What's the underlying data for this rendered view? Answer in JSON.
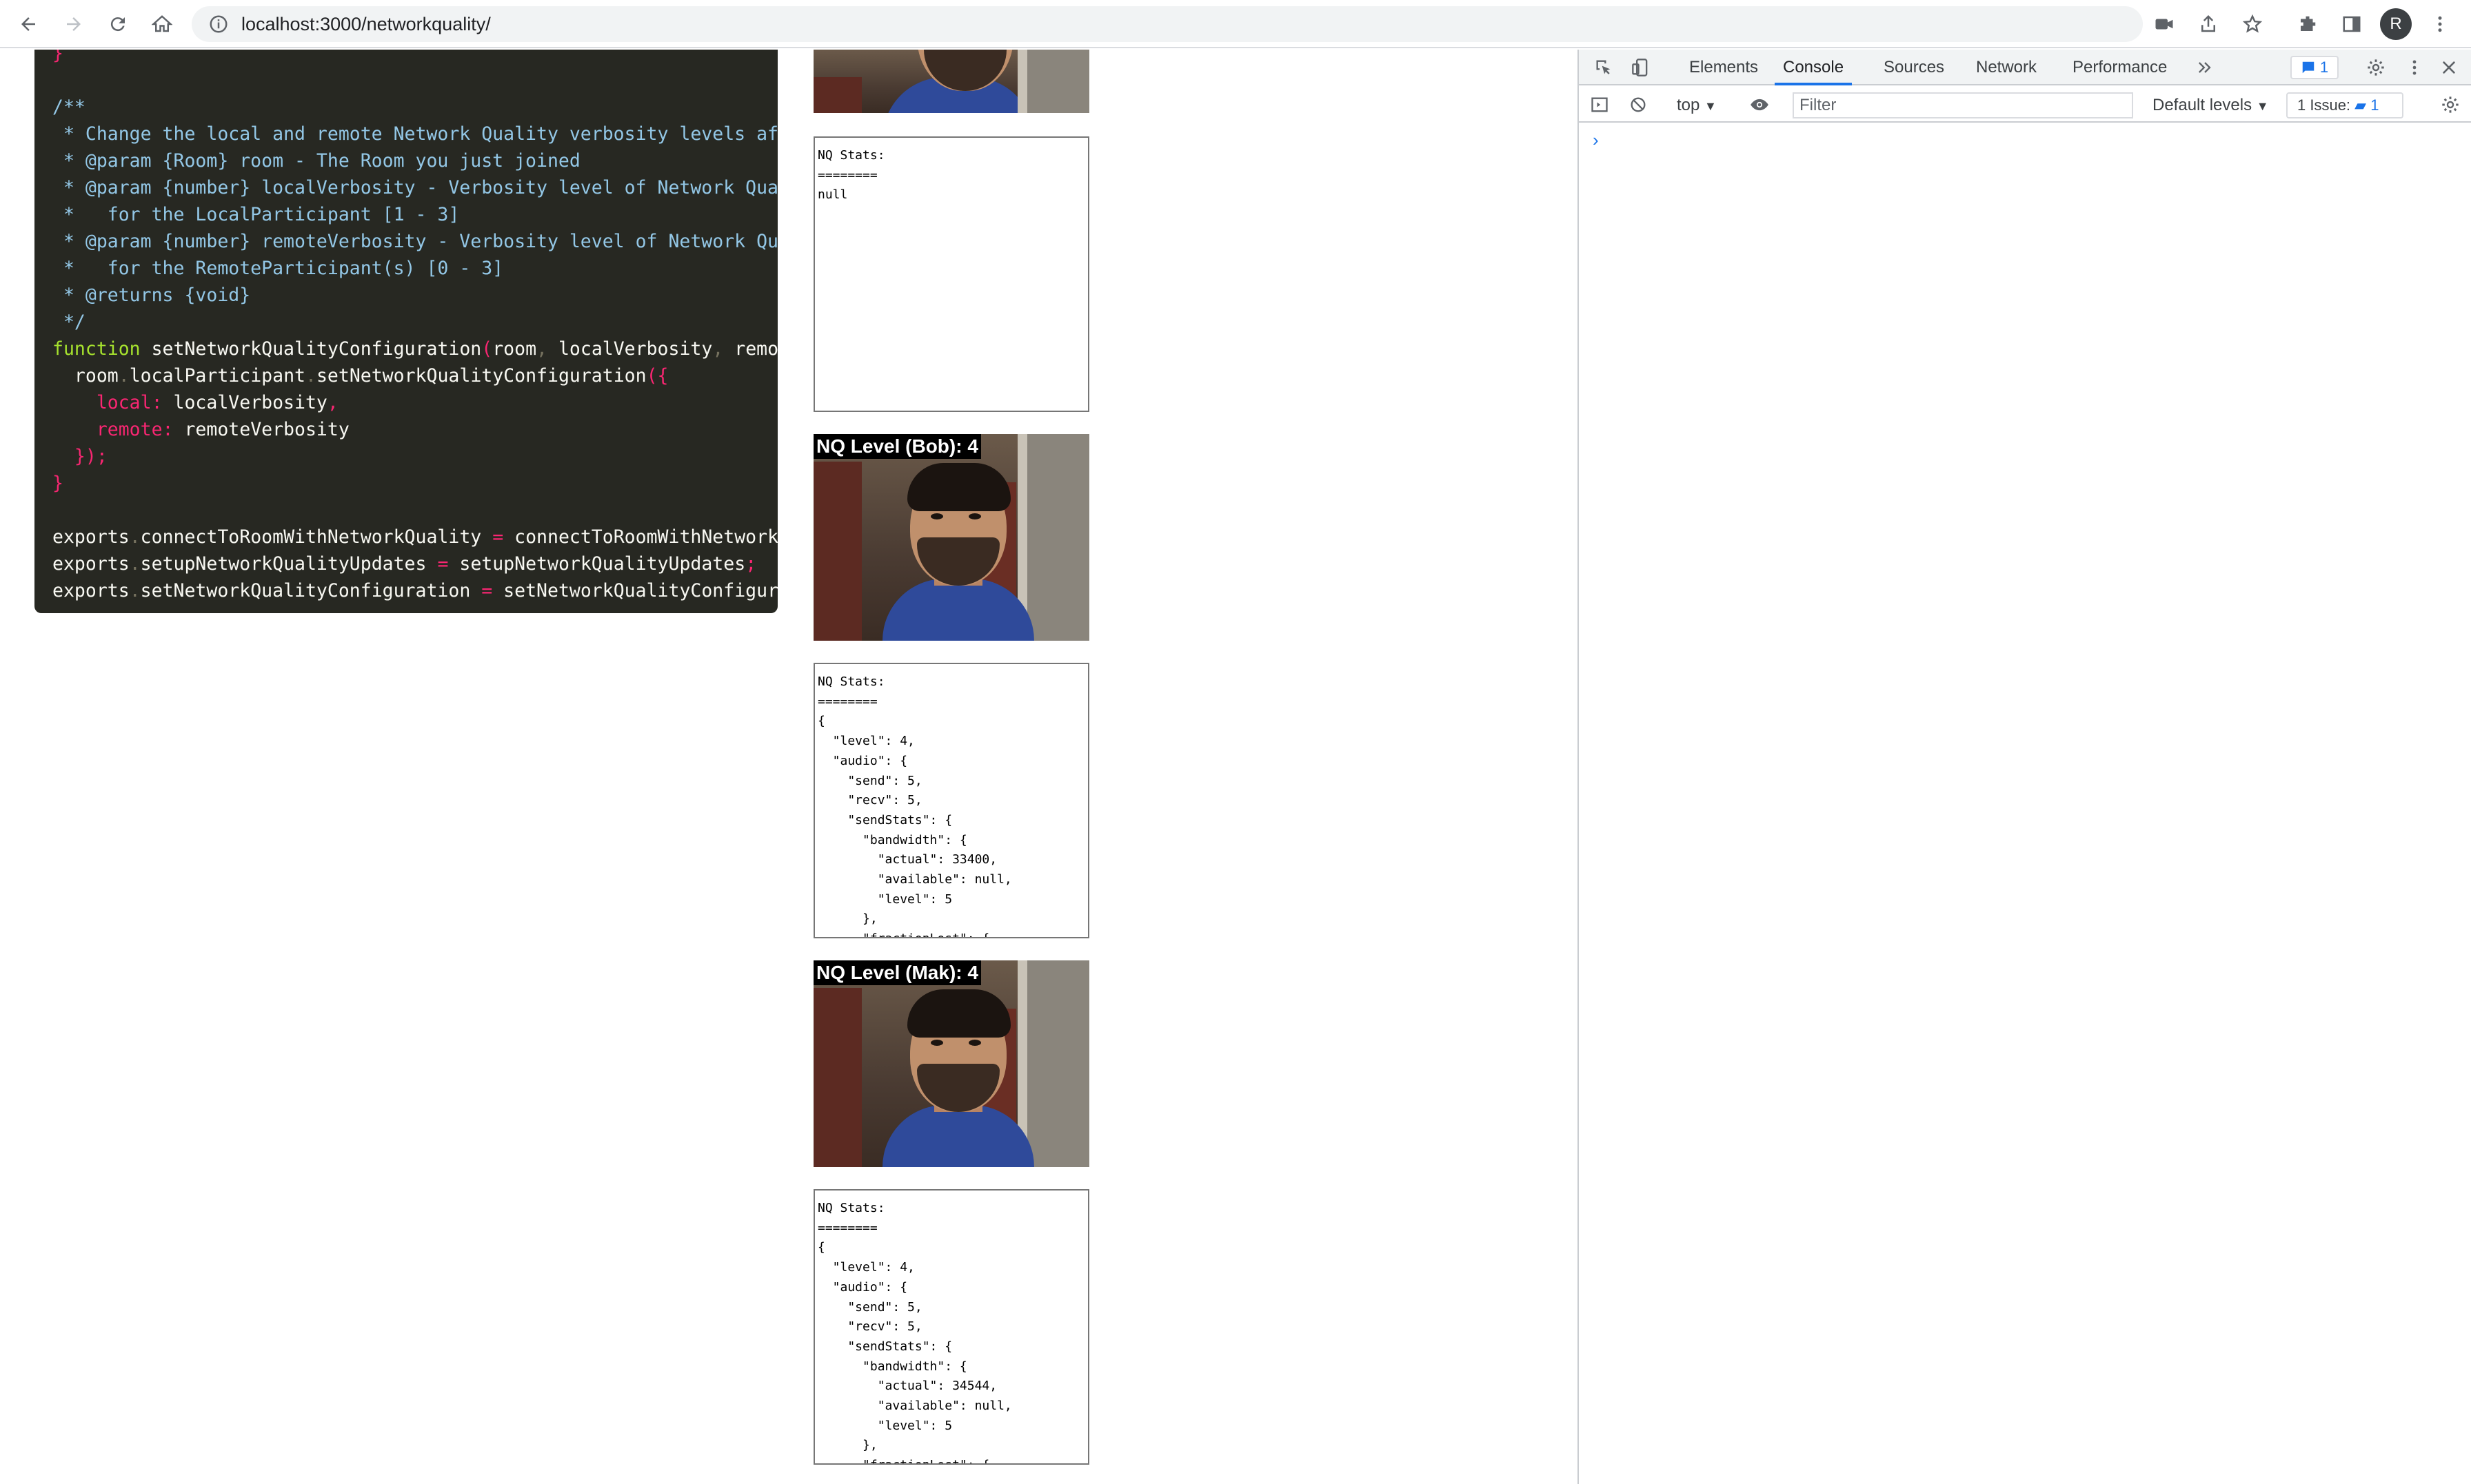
{
  "browser": {
    "url": "localhost:3000/networkquality/",
    "profile_initial": "R"
  },
  "code": {
    "lines": [
      [
        [
          "c-punc",
          "}"
        ]
      ],
      [],
      [
        [
          "c-com",
          "/**"
        ]
      ],
      [
        [
          "c-com",
          " * Change the local and remote Network Quality verbosity levels afte"
        ]
      ],
      [
        [
          "c-com",
          " * @param {Room} room - The Room you just joined"
        ]
      ],
      [
        [
          "c-com",
          " * @param {number} localVerbosity - Verbosity level of Network Quali"
        ]
      ],
      [
        [
          "c-com",
          " *   for the LocalParticipant [1 - 3]"
        ]
      ],
      [
        [
          "c-com",
          " * @param {number} remoteVerbosity - Verbosity level of Network Qual"
        ]
      ],
      [
        [
          "c-com",
          " *   for the RemoteParticipant(s) [0 - 3]"
        ]
      ],
      [
        [
          "c-com",
          " * @returns {void}"
        ]
      ],
      [
        [
          "c-com",
          " */"
        ]
      ],
      [
        [
          "c-kw",
          "function "
        ],
        [
          "c-plain",
          "setNetworkQualityConfiguration"
        ],
        [
          "c-punc",
          "("
        ],
        [
          "c-plain",
          "room"
        ],
        [
          "c-dot",
          ", "
        ],
        [
          "c-plain",
          "localVerbosity"
        ],
        [
          "c-dot",
          ", "
        ],
        [
          "c-plain",
          "remote"
        ]
      ],
      [
        [
          "c-plain",
          "  room"
        ],
        [
          "c-dot",
          "."
        ],
        [
          "c-plain",
          "localParticipant"
        ],
        [
          "c-dot",
          "."
        ],
        [
          "c-plain",
          "setNetworkQualityConfiguration"
        ],
        [
          "c-punc",
          "({"
        ]
      ],
      [
        [
          "c-key",
          "    local"
        ],
        [
          "c-punc",
          ": "
        ],
        [
          "c-plain",
          "localVerbosity"
        ],
        [
          "c-punc",
          ","
        ]
      ],
      [
        [
          "c-key",
          "    remote"
        ],
        [
          "c-punc",
          ": "
        ],
        [
          "c-plain",
          "remoteVerbosity"
        ]
      ],
      [
        [
          "c-punc",
          "  });"
        ]
      ],
      [
        [
          "c-punc",
          "}"
        ]
      ],
      [],
      [
        [
          "c-plain",
          "exports"
        ],
        [
          "c-dot",
          "."
        ],
        [
          "c-plain",
          "connectToRoomWithNetworkQuality "
        ],
        [
          "c-punc",
          "= "
        ],
        [
          "c-plain",
          "connectToRoomWithNetworkQu"
        ]
      ],
      [
        [
          "c-plain",
          "exports"
        ],
        [
          "c-dot",
          "."
        ],
        [
          "c-plain",
          "setupNetworkQualityUpdates "
        ],
        [
          "c-punc",
          "= "
        ],
        [
          "c-plain",
          "setupNetworkQualityUpdates"
        ],
        [
          "c-punc",
          ";"
        ]
      ],
      [
        [
          "c-plain",
          "exports"
        ],
        [
          "c-dot",
          "."
        ],
        [
          "c-plain",
          "setNetworkQualityConfiguration "
        ],
        [
          "c-punc",
          "= "
        ],
        [
          "c-plain",
          "setNetworkQualityConfigurat"
        ]
      ]
    ]
  },
  "participants": {
    "local_stats": "NQ Stats:\n========\nnull",
    "bob": {
      "label": "NQ Level (Bob): 4",
      "stats": "NQ Stats:\n========\n{\n  \"level\": 4,\n  \"audio\": {\n    \"send\": 5,\n    \"recv\": 5,\n    \"sendStats\": {\n      \"bandwidth\": {\n        \"actual\": 33400,\n        \"available\": null,\n        \"level\": 5\n      },\n      \"fractionLost\": {"
    },
    "mak": {
      "label": "NQ Level (Mak): 4",
      "stats": "NQ Stats:\n========\n{\n  \"level\": 4,\n  \"audio\": {\n    \"send\": 5,\n    \"recv\": 5,\n    \"sendStats\": {\n      \"bandwidth\": {\n        \"actual\": 34544,\n        \"available\": null,\n        \"level\": 5\n      },\n      \"fractionLost\": {"
    }
  },
  "devtools": {
    "tabs": [
      "Elements",
      "Console",
      "Sources",
      "Network",
      "Performance"
    ],
    "active_tab": "Console",
    "messages_badge": "1",
    "context": "top",
    "filter_placeholder": "Filter",
    "levels": "Default levels",
    "issues_label": "1 Issue:",
    "issues_count": "1",
    "prompt": "›"
  },
  "colors": {
    "code_bg": "#272822",
    "accent": "#1a73e8"
  }
}
